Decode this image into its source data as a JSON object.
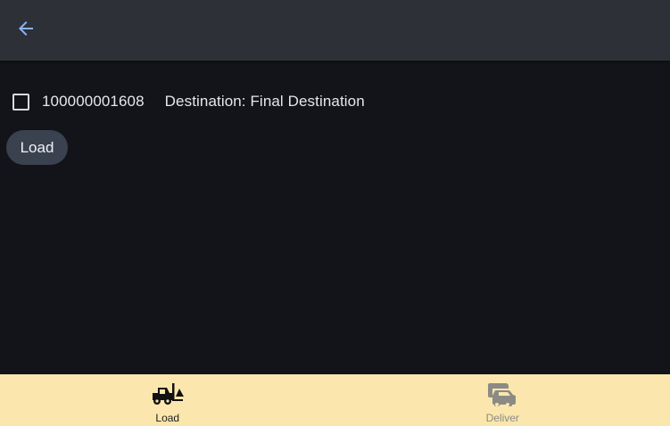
{
  "appbar": {
    "back_icon": "arrow-left-icon",
    "accent": "#8ab4f8"
  },
  "shipment": {
    "id": "100000001608",
    "destination": "Destination: Final Destination",
    "checked": false
  },
  "actions": {
    "load_label": "Load"
  },
  "bottom_nav": {
    "items": [
      {
        "label": "Load",
        "icon": "forklift-icon",
        "active": true
      },
      {
        "label": "Deliver",
        "icon": "truck-delivery-icon",
        "active": false
      }
    ]
  },
  "colors": {
    "background": "#121419",
    "appbar": "#2d3036",
    "nav_background": "#fbe7ad",
    "button": "#3a4250"
  }
}
